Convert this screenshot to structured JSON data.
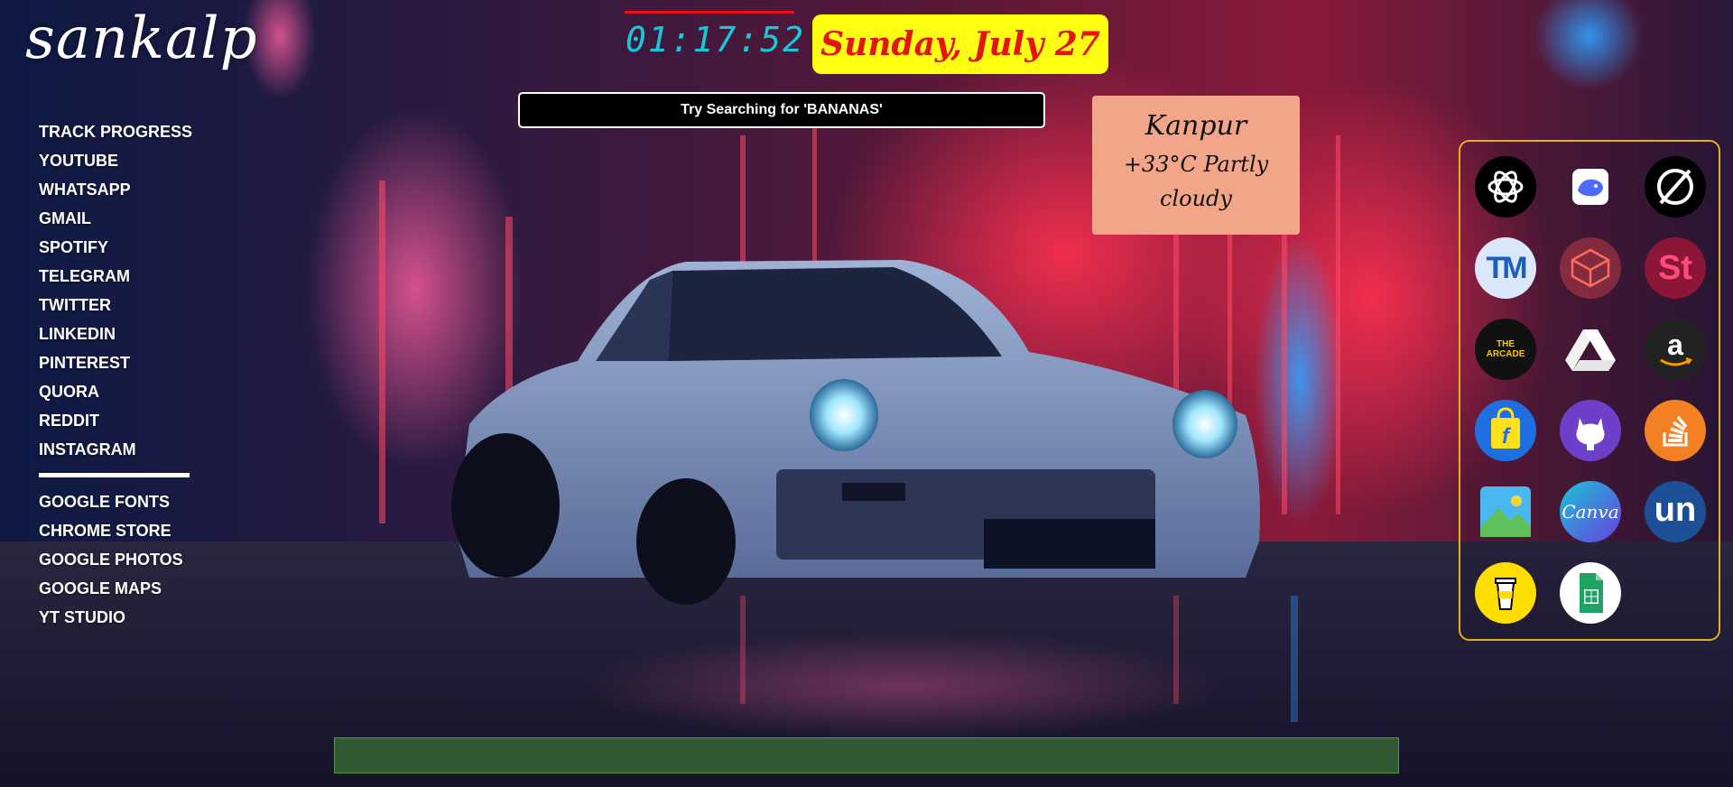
{
  "branding": {
    "logo": "sankalp"
  },
  "nav": {
    "main": [
      "TRACK PROGRESS",
      "YOUTUBE",
      "WHATSAPP",
      "GMAIL",
      "SPOTIFY",
      "TELEGRAM",
      "TWITTER",
      "LINKEDIN",
      "PINTEREST",
      "QUORA",
      "REDDIT",
      "INSTAGRAM"
    ],
    "tools": [
      "GOOGLE FONTS",
      "CHROME STORE",
      "GOOGLE PHOTOS",
      "GOOGLE MAPS",
      "YT STUDIO"
    ]
  },
  "clock": {
    "time": "01:17:52",
    "color": "#19c8d8"
  },
  "date": {
    "text": "Sunday, July 27",
    "bg_color": "#ffff14",
    "text_color": "#e3160f"
  },
  "search": {
    "placeholder": "Try Searching for 'BANANAS'"
  },
  "weather": {
    "city": "Kanpur",
    "condition": "+33°C Partly cloudy",
    "bg_color": "#f2a589"
  },
  "apps": [
    {
      "id": "chatgpt",
      "icon": "chatgpt-icon",
      "label": ""
    },
    {
      "id": "deepseek",
      "icon": "deepseek-whale-icon",
      "label": ""
    },
    {
      "id": "perplexity",
      "icon": "slashed-circle-icon",
      "label": ""
    },
    {
      "id": "typingmaster",
      "icon": "tm-logo-icon",
      "label": "TM"
    },
    {
      "id": "codesandbox",
      "icon": "cube-outline-icon",
      "label": ""
    },
    {
      "id": "studocu",
      "icon": "st-logo-icon",
      "label": "St"
    },
    {
      "id": "arcade",
      "icon": "arcade-badge-icon",
      "label": "THE ARCADE"
    },
    {
      "id": "google-drive",
      "icon": "drive-triangle-icon",
      "label": ""
    },
    {
      "id": "amazon",
      "icon": "amazon-icon",
      "label": "a"
    },
    {
      "id": "flipkart",
      "icon": "flipkart-bag-icon",
      "label": "f"
    },
    {
      "id": "github",
      "icon": "github-cat-icon",
      "label": ""
    },
    {
      "id": "stack-overflow",
      "icon": "stack-overflow-icon",
      "label": ""
    },
    {
      "id": "gallery",
      "icon": "landscape-image-icon",
      "label": ""
    },
    {
      "id": "canva",
      "icon": "canva-icon",
      "label": "Canva"
    },
    {
      "id": "unstop",
      "icon": "unstop-icon",
      "label": "un"
    },
    {
      "id": "buy-me-a-coffee",
      "icon": "coffee-cup-icon",
      "label": ""
    },
    {
      "id": "google-sheets",
      "icon": "sheets-icon",
      "label": ""
    }
  ]
}
